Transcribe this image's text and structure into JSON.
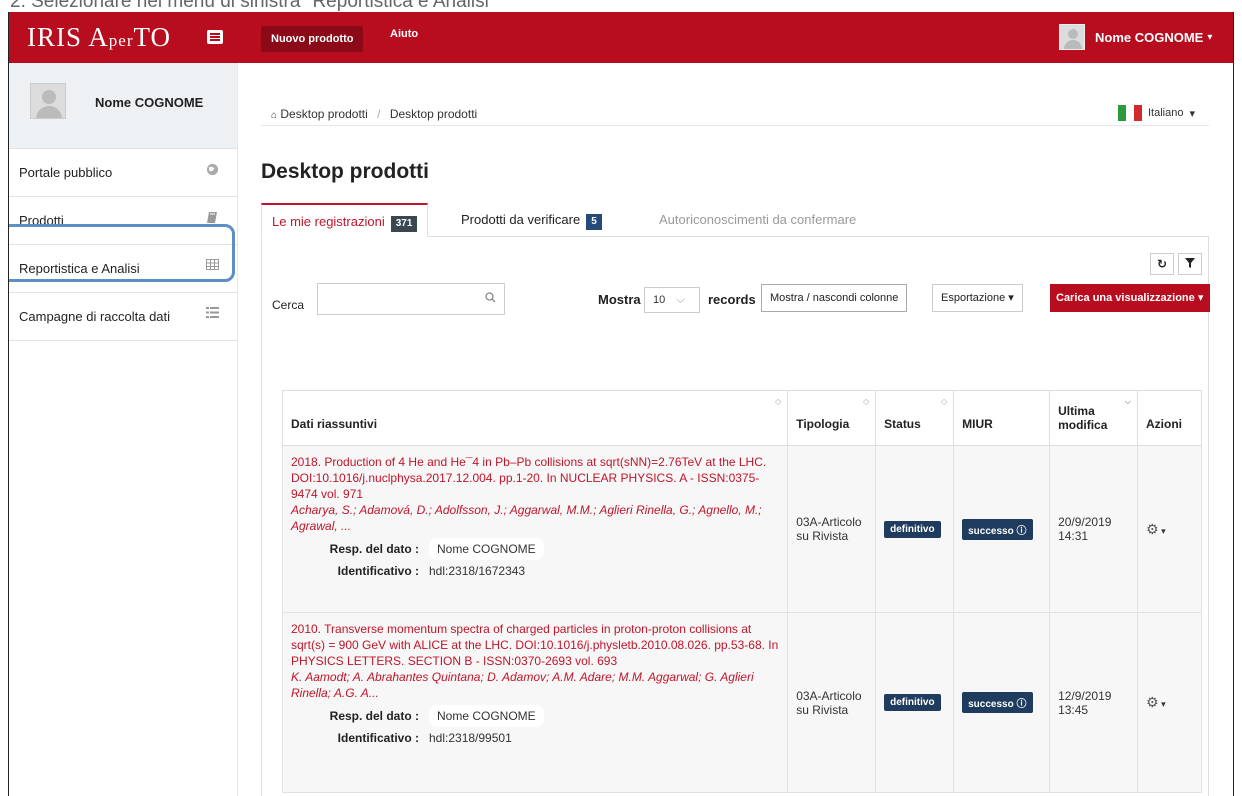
{
  "caption": "2.  Selezionare nel menu di sinistra \"Reportistica e Analisi\"",
  "topbar": {
    "logo_main": "IRIS A",
    "logo_small": "per",
    "logo_end": "TO",
    "new_product": "Nuovo prodotto",
    "help": "Aiuto",
    "user": "Nome COGNOME"
  },
  "sidebar": {
    "username": "Nome COGNOME",
    "items": [
      {
        "label": "Portale pubblico",
        "icon": "globe-icon"
      },
      {
        "label": "Prodotti",
        "icon": "book-icon"
      },
      {
        "label": "Reportistica e Analisi",
        "icon": "table-icon"
      },
      {
        "label": "Campagne di raccolta dati",
        "icon": "list-icon"
      }
    ]
  },
  "breadcrumb": {
    "home": "Desktop prodotti",
    "current": "Desktop prodotti"
  },
  "language": "Italiano",
  "page_title": "Desktop prodotti",
  "tabs": [
    {
      "label": "Le mie registrazioni",
      "count": "371"
    },
    {
      "label": "Prodotti da verificare",
      "count": "5"
    },
    {
      "label": "Autoriconoscimenti da confermare"
    }
  ],
  "toolbar": {
    "search_label": "Cerca",
    "show_label": "Mostra",
    "show_value": "10",
    "records_label": "records",
    "columns_button": "Mostra / nascondi colonne",
    "export_button": "Esportazione",
    "load_view_button": "Carica una visualizzazione"
  },
  "table": {
    "headers": [
      "Dati riassuntivi",
      "Tipologia",
      "Status",
      "MIUR",
      "Ultima modifica",
      "Azioni"
    ],
    "meta_labels": {
      "resp": "Resp. del dato :",
      "ident": "Identificativo :"
    },
    "rows": [
      {
        "title": "2018. Production of 4 He and He¯4 in Pb–Pb collisions at sqrt(sNN)=2.76TeV at the LHC. DOI:10.1016/j.nuclphysa.2017.12.004. pp.1-20. In NUCLEAR PHYSICS. A - ISSN:0375-9474 vol. 971",
        "authors": "Acharya, S.; Adamová, D.; Adolfsson, J.; Aggarwal, M.M.; Aglieri Rinella, G.; Agnello, M.; Agrawal, ...",
        "resp": "Nome COGNOME",
        "ident": "hdl:2318/1672343",
        "type": "03A-Articolo su Rivista",
        "status": "definitivo",
        "miur": "successo",
        "modified": "20/9/2019 14:31"
      },
      {
        "title": "2010. Transverse momentum spectra of charged particles in proton-proton collisions at sqrt(s) = 900 GeV with ALICE at the LHC. DOI:10.1016/j.physletb.2010.08.026. pp.53-68. In PHYSICS LETTERS. SECTION B - ISSN:0370-2693 vol. 693",
        "authors": "K. Aamodt; A. Abrahantes Quintana; D. Adamov; A.M. Adare; M.M. Aggarwal; G. Aglieri Rinella; A.G. A...",
        "resp": "Nome COGNOME",
        "ident": "hdl:2318/99501",
        "type": "03A-Articolo su Rivista",
        "status": "definitivo",
        "miur": "successo",
        "modified": "12/9/2019 13:45"
      }
    ]
  },
  "colors": {
    "brand": "#b80c1f",
    "highlight": "#5b8fc7",
    "badge": "#1f3b5e"
  }
}
